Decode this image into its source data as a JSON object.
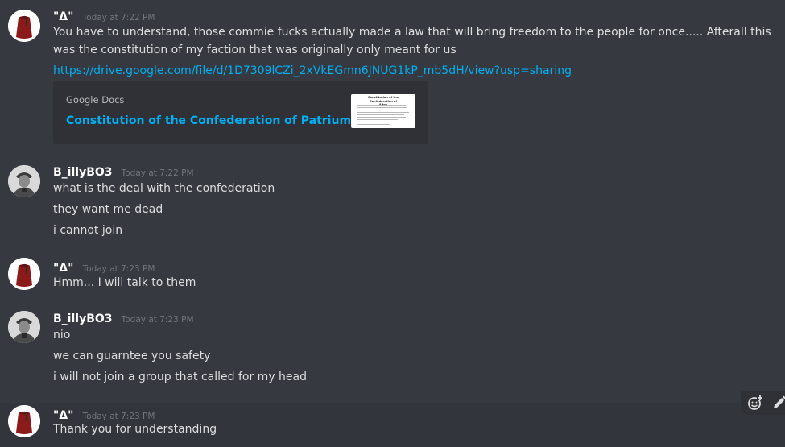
{
  "messages": [
    {
      "username": "\"Δ\"",
      "timestamp": "Today at 7:22 PM",
      "avatar": "fez-avatar",
      "lines": [
        "You have to understand, those commie fucks actually made a law that will bring freedom to the people for once..... Afterall this was the constitution of my faction that was originally only meant for us"
      ],
      "link": "https://drive.google.com/file/d/1D7309lCZi_2xVkEGmn6JNUG1kP_mb5dH/view?usp=sharing",
      "embed": {
        "provider": "Google Docs",
        "title": "Constitution of the Confederation of Patrium.docx",
        "thumb_heading": "Constitution of the Confederation of Altos"
      }
    },
    {
      "username": "B_illyBO3",
      "timestamp": "Today at 7:22 PM",
      "avatar": "soldier-avatar",
      "lines": [
        "what is the deal with the confederation",
        "they want me dead",
        "i cannot join"
      ]
    },
    {
      "username": "\"Δ\"",
      "timestamp": "Today at 7:23 PM",
      "avatar": "fez-avatar",
      "lines": [
        "Hmm... I will talk to them"
      ]
    },
    {
      "username": "B_illyBO3",
      "timestamp": "Today at 7:23 PM",
      "avatar": "soldier-avatar",
      "lines": [
        "nio",
        "we can guarntee you safety",
        "i will not join a group that called for my head"
      ]
    },
    {
      "username": "\"Δ\"",
      "timestamp": "Today at 7:23 PM",
      "avatar": "fez-avatar",
      "lines": [
        "Thank you for understanding"
      ]
    }
  ],
  "hover_actions": [
    "add-reaction-icon",
    "edit-icon"
  ],
  "colors": {
    "background": "#36393f",
    "embed_background": "#2f3136",
    "link": "#00b0f4",
    "username": "#ffffff",
    "timestamp": "#72767d",
    "fez": "#8b1a1a"
  }
}
